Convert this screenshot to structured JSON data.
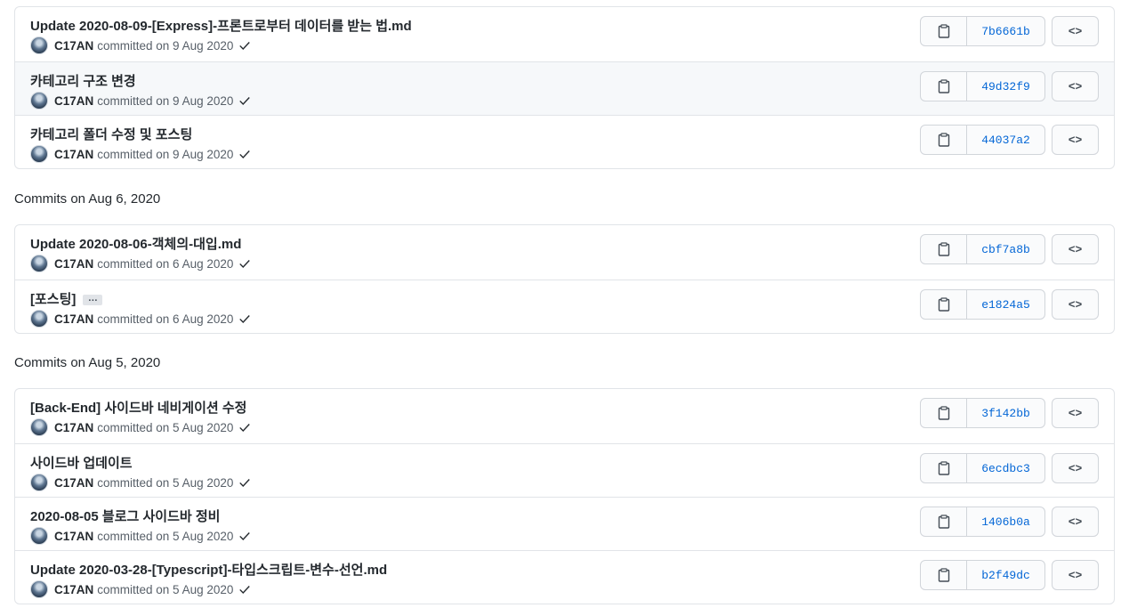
{
  "groups": [
    {
      "heading": "",
      "commits": [
        {
          "message": "Update 2020-08-09-[Express]-프론트로부터 데이터를 받는 법.md",
          "author": "C17AN",
          "committed": "committed on 9 Aug 2020",
          "sha": "7b6661b"
        },
        {
          "message": "카테고리 구조 변경",
          "author": "C17AN",
          "committed": "committed on 9 Aug 2020",
          "sha": "49d32f9"
        },
        {
          "message": "카테고리 폴더 수정 및 포스팅",
          "author": "C17AN",
          "committed": "committed on 9 Aug 2020",
          "sha": "44037a2"
        }
      ]
    },
    {
      "heading": "Commits on Aug 6, 2020",
      "commits": [
        {
          "message": "Update 2020-08-06-객체의-대입.md",
          "author": "C17AN",
          "committed": "committed on 6 Aug 2020",
          "sha": "cbf7a8b"
        },
        {
          "message": "[포스팅]",
          "author": "C17AN",
          "committed": "committed on 6 Aug 2020",
          "sha": "e1824a5",
          "ellipsis": "…"
        }
      ]
    },
    {
      "heading": "Commits on Aug 5, 2020",
      "commits": [
        {
          "message": "[Back-End] 사이드바 네비게이션 수정",
          "author": "C17AN",
          "committed": "committed on 5 Aug 2020",
          "sha": "3f142bb"
        },
        {
          "message": "사이드바 업데이트",
          "author": "C17AN",
          "committed": "committed on 5 Aug 2020",
          "sha": "6ecdbc3"
        },
        {
          "message": "2020-08-05 블로그 사이드바 정비",
          "author": "C17AN",
          "committed": "committed on 5 Aug 2020",
          "sha": "1406b0a"
        },
        {
          "message": "Update 2020-03-28-[Typescript]-타입스크립트-변수-선언.md",
          "author": "C17AN",
          "committed": "committed on 5 Aug 2020",
          "sha": "b2f49dc"
        }
      ]
    }
  ],
  "icons": {
    "copy": "clipboard-icon",
    "browse": "code-icon",
    "status": "check-icon"
  },
  "browse_label": "<>",
  "colors": {
    "sha": "#0366d6",
    "hover_row": "#f6f8fa",
    "border": "#e1e4e8"
  }
}
